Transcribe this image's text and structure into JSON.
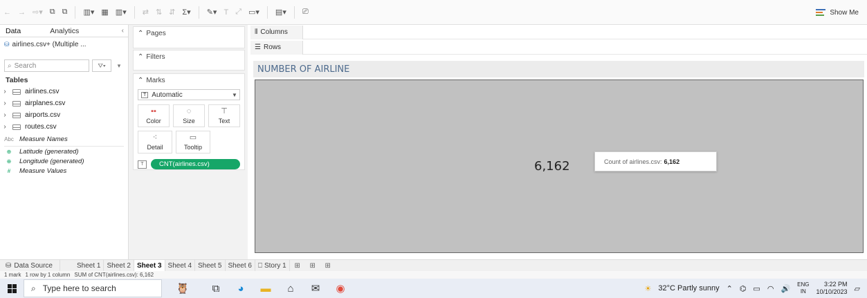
{
  "toolbar": {
    "show_me_label": "Show Me"
  },
  "data_pane": {
    "tabs": [
      "Data",
      "Analytics"
    ],
    "datasource": "airlines.csv+ (Multiple ...",
    "search_placeholder": "Search",
    "tables_heading": "Tables",
    "tables": [
      "airlines.csv",
      "airplanes.csv",
      "airports.csv",
      "routes.csv"
    ],
    "fields": [
      {
        "type": "Abc",
        "name": "Measure Names"
      },
      {
        "type": "globe",
        "name": "Latitude (generated)"
      },
      {
        "type": "globe",
        "name": "Longitude (generated)"
      },
      {
        "type": "#",
        "name": "Measure Values"
      }
    ]
  },
  "cards": {
    "pages": "Pages",
    "filters": "Filters",
    "marks": "Marks",
    "mark_type": "Automatic",
    "mark_buttons": [
      "Color",
      "Size",
      "Text",
      "Detail",
      "Tooltip"
    ],
    "pill": "CNT(airlines.csv)"
  },
  "shelves": {
    "columns": "Columns",
    "rows": "Rows"
  },
  "view": {
    "title": "NUMBER OF AIRLINE",
    "value": "6,162",
    "tooltip_label": "Count of airlines.csv:",
    "tooltip_value": "6,162",
    "background_color": "#c1c1c1"
  },
  "sheet_tabs": {
    "data_source": "Data Source",
    "sheets": [
      "Sheet 1",
      "Sheet 2",
      "Sheet 3",
      "Sheet 4",
      "Sheet 5",
      "Sheet 6"
    ],
    "active_sheet": "Sheet 3",
    "story": "Story 1"
  },
  "status_bar": {
    "marks": "1 mark",
    "dims": "1 row by 1 column",
    "sum": "SUM of CNT(airlines.csv): 6,162"
  },
  "taskbar": {
    "search_placeholder": "Type here to search",
    "weather": "32°C  Partly sunny",
    "lang_top": "ENG",
    "lang_bottom": "IN",
    "time": "3:22 PM",
    "date": "10/10/2023"
  },
  "colors": {
    "pill": "#16a668",
    "title": "#4d6a8c"
  }
}
